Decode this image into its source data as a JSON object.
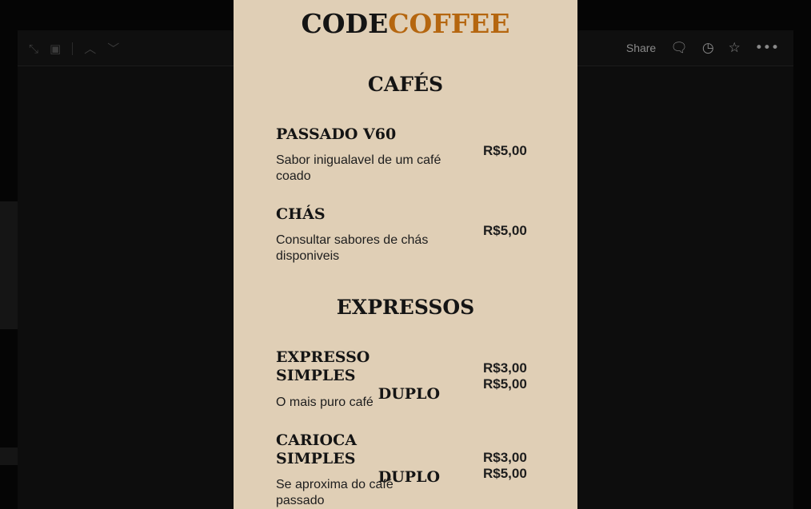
{
  "toolbar": {
    "share_label": "Share",
    "icons": [
      "expand-icon",
      "monitor-icon",
      "chevron-up-icon",
      "chevron-down-icon",
      "comment-icon",
      "history-icon",
      "star-icon",
      "more-icon"
    ]
  },
  "menu": {
    "brand": {
      "part1": "CODE",
      "part2": "COFFEE"
    },
    "colors": {
      "background": "#e0cfb6",
      "accent": "#b5660f",
      "text": "#141414"
    },
    "sections": [
      {
        "title": "CAFÉS",
        "items": [
          {
            "title": "PASSADO V60",
            "desc": "Sabor inigualavel de um café coado",
            "prices": [
              "R$5,00"
            ]
          },
          {
            "title": "CHÁS",
            "desc": "Consultar sabores de chás disponiveis",
            "prices": [
              "R$5,00"
            ]
          }
        ]
      },
      {
        "title": "EXPRESSOS",
        "items": [
          {
            "title": "EXPRESSO SIMPLES",
            "title2": "DUPLO",
            "desc": "O mais puro café",
            "prices": [
              "R$3,00",
              "R$5,00"
            ]
          },
          {
            "title": "CARIOCA SIMPLES",
            "title2": "DUPLO",
            "desc": "Se aproxima do café passado",
            "prices": [
              "R$3,00",
              "R$5,00"
            ]
          }
        ]
      }
    ]
  }
}
